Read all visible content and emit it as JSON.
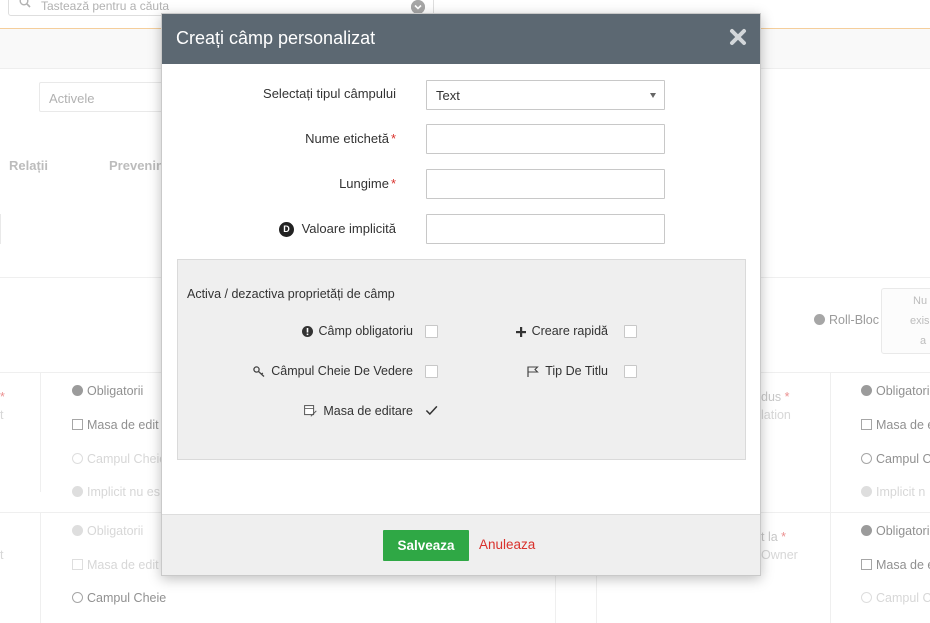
{
  "background": {
    "search_placeholder": "Tastează pentru a căuta",
    "filter_select": "Activele",
    "tabs": [
      "Relații",
      "Prevenin"
    ],
    "roll_bloc": "Roll-Bloc",
    "right_box": [
      "Nu",
      "exis",
      "a"
    ],
    "left_col_fragments": [
      "*",
      "t",
      "t"
    ],
    "col2_rows": [
      {
        "label": "Obligatorii",
        "faded": false
      },
      {
        "label": "Masa de edit",
        "faded": false
      },
      {
        "label": "Campul Cheie",
        "faded": true
      },
      {
        "label": "Implicit nu es",
        "faded": true
      },
      {
        "label": "Obligatorii",
        "faded": true
      },
      {
        "label": "Masa de edit",
        "faded": true
      },
      {
        "label": "Campul Cheie",
        "faded": false
      }
    ],
    "col3_fragments": [
      "dus",
      "lation",
      "t la",
      "Owner"
    ],
    "col4_rows": [
      {
        "label": "Obligatori",
        "faded": false
      },
      {
        "label": "Masa de e",
        "faded": false
      },
      {
        "label": "Campul C",
        "faded": false
      },
      {
        "label": "Implicit n",
        "faded": true
      },
      {
        "label": "Obligatori",
        "faded": false
      },
      {
        "label": "Masa de e",
        "faded": false
      },
      {
        "label": "Campul C",
        "faded": true
      }
    ]
  },
  "modal": {
    "title": "Creați câmp personalizat",
    "field_type_label": "Selectați tipul câmpului",
    "field_type_value": "Text",
    "label_name_label": "Nume etichetă",
    "length_label": "Lungime",
    "default_value_label": "Valoare implicită",
    "default_badge": "D",
    "required_mark": "*",
    "properties_title": "Activa / dezactiva proprietăți de câmp",
    "properties": {
      "required": {
        "label": "Câmp obligatoriu",
        "checked": false
      },
      "quick_create": {
        "label": "Creare rapidă",
        "checked": false
      },
      "key_view": {
        "label": "Câmpul Cheie De Vedere",
        "checked": false
      },
      "title_type": {
        "label": "Tip De Titlu",
        "checked": false
      },
      "edit_table": {
        "label": "Masa de editare",
        "checked": true
      }
    },
    "save_label": "Salveaza",
    "cancel_label": "Anuleaza"
  },
  "colors": {
    "header_bg": "#5c6872",
    "save_green": "#2fa845",
    "cancel_red": "#d9312c",
    "required_red": "#d9312c"
  }
}
